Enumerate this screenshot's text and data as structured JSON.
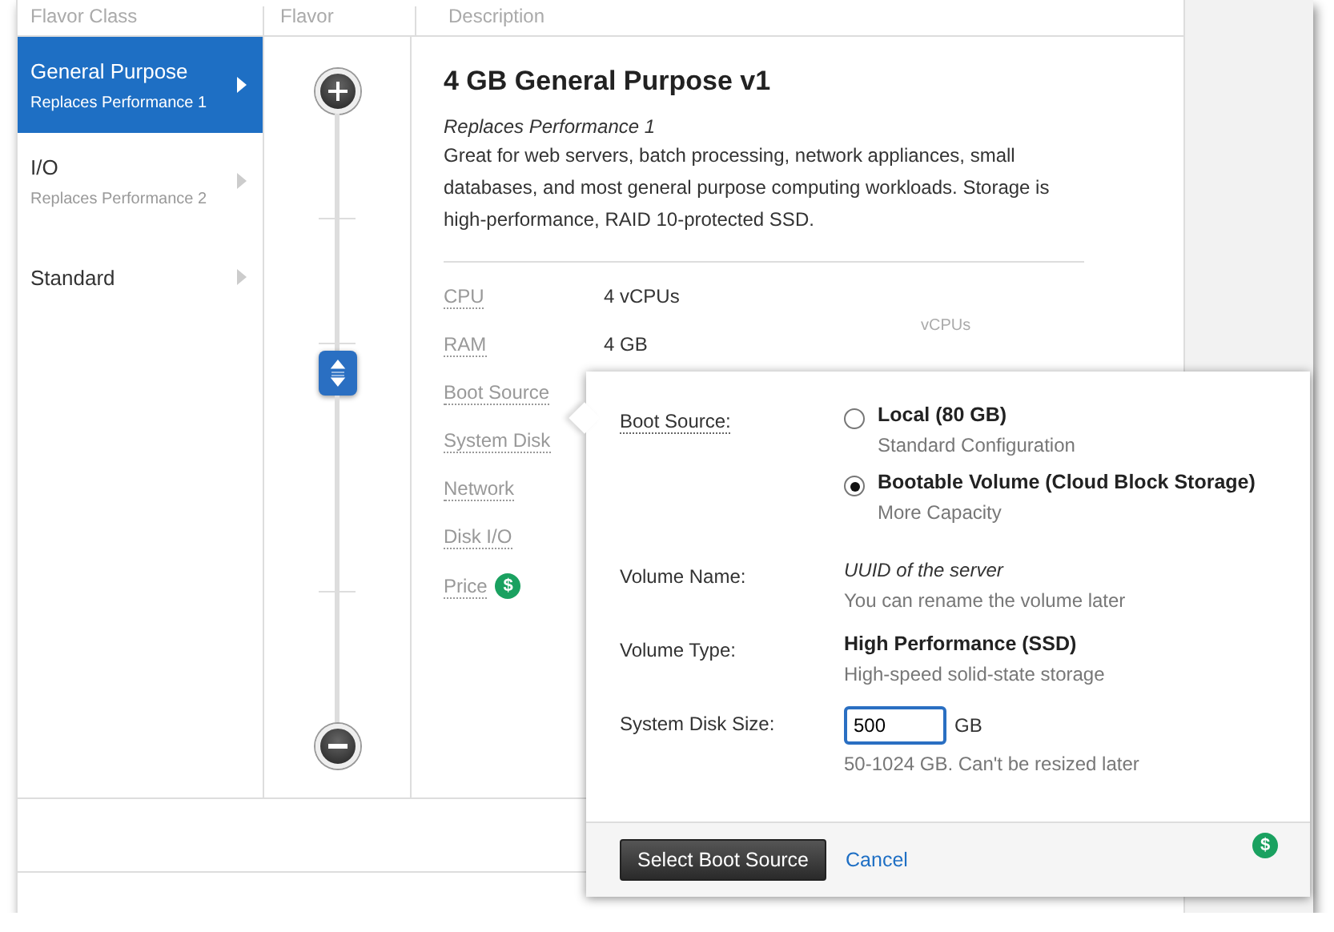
{
  "table": {
    "columns": [
      "Flavor Class",
      "Flavor",
      "Description"
    ]
  },
  "sidebar": {
    "items": [
      {
        "label": "General Purpose",
        "sublabel": "Replaces Performance 1",
        "selected": true
      },
      {
        "label": "I/O",
        "sublabel": "Replaces Performance 2",
        "selected": false
      },
      {
        "label": "Standard",
        "selected": false
      }
    ]
  },
  "flavor_slider": {
    "level": 0.58
  },
  "description": {
    "title": "4 GB General Purpose v1",
    "subtitle": "Replaces Performance 1",
    "text": "Great for web servers, batch processing, network appliances, small databases, and most general purpose computing workloads. Storage is high-performance, RAID 10-protected SSD.",
    "specs": [
      {
        "label": "CPU",
        "value": "4 vCPUs"
      },
      {
        "label": "RAM",
        "value": "4 GB"
      },
      {
        "label": "Boot Source"
      },
      {
        "label": "System Disk"
      },
      {
        "label": "Network"
      },
      {
        "label": "Disk I/O"
      },
      {
        "label": "Price",
        "badge": "$"
      }
    ],
    "column_label": "vCPUs"
  },
  "popover": {
    "boot_source_label": "Boot Source:",
    "options": [
      {
        "label": "Local (80 GB)",
        "note": "Standard Configuration",
        "selected": false
      },
      {
        "label": "Bootable Volume (Cloud Block Storage)",
        "note": "More Capacity",
        "selected": true
      }
    ],
    "volume_name_label": "Volume Name:",
    "volume_name": "UUID of the server",
    "volume_name_note": "You can rename the volume later",
    "volume_type_label": "Volume Type:",
    "volume_type": "High Performance (SSD)",
    "volume_type_note": "High-speed solid-state storage",
    "disk_size_label": "System Disk Size:",
    "disk_size": "500",
    "disk_size_unit": "GB",
    "disk_size_note": "50-1024 GB. Can't be resized later",
    "submit": "Select Boot Source",
    "cancel": "Cancel",
    "footer_badge": "$"
  }
}
